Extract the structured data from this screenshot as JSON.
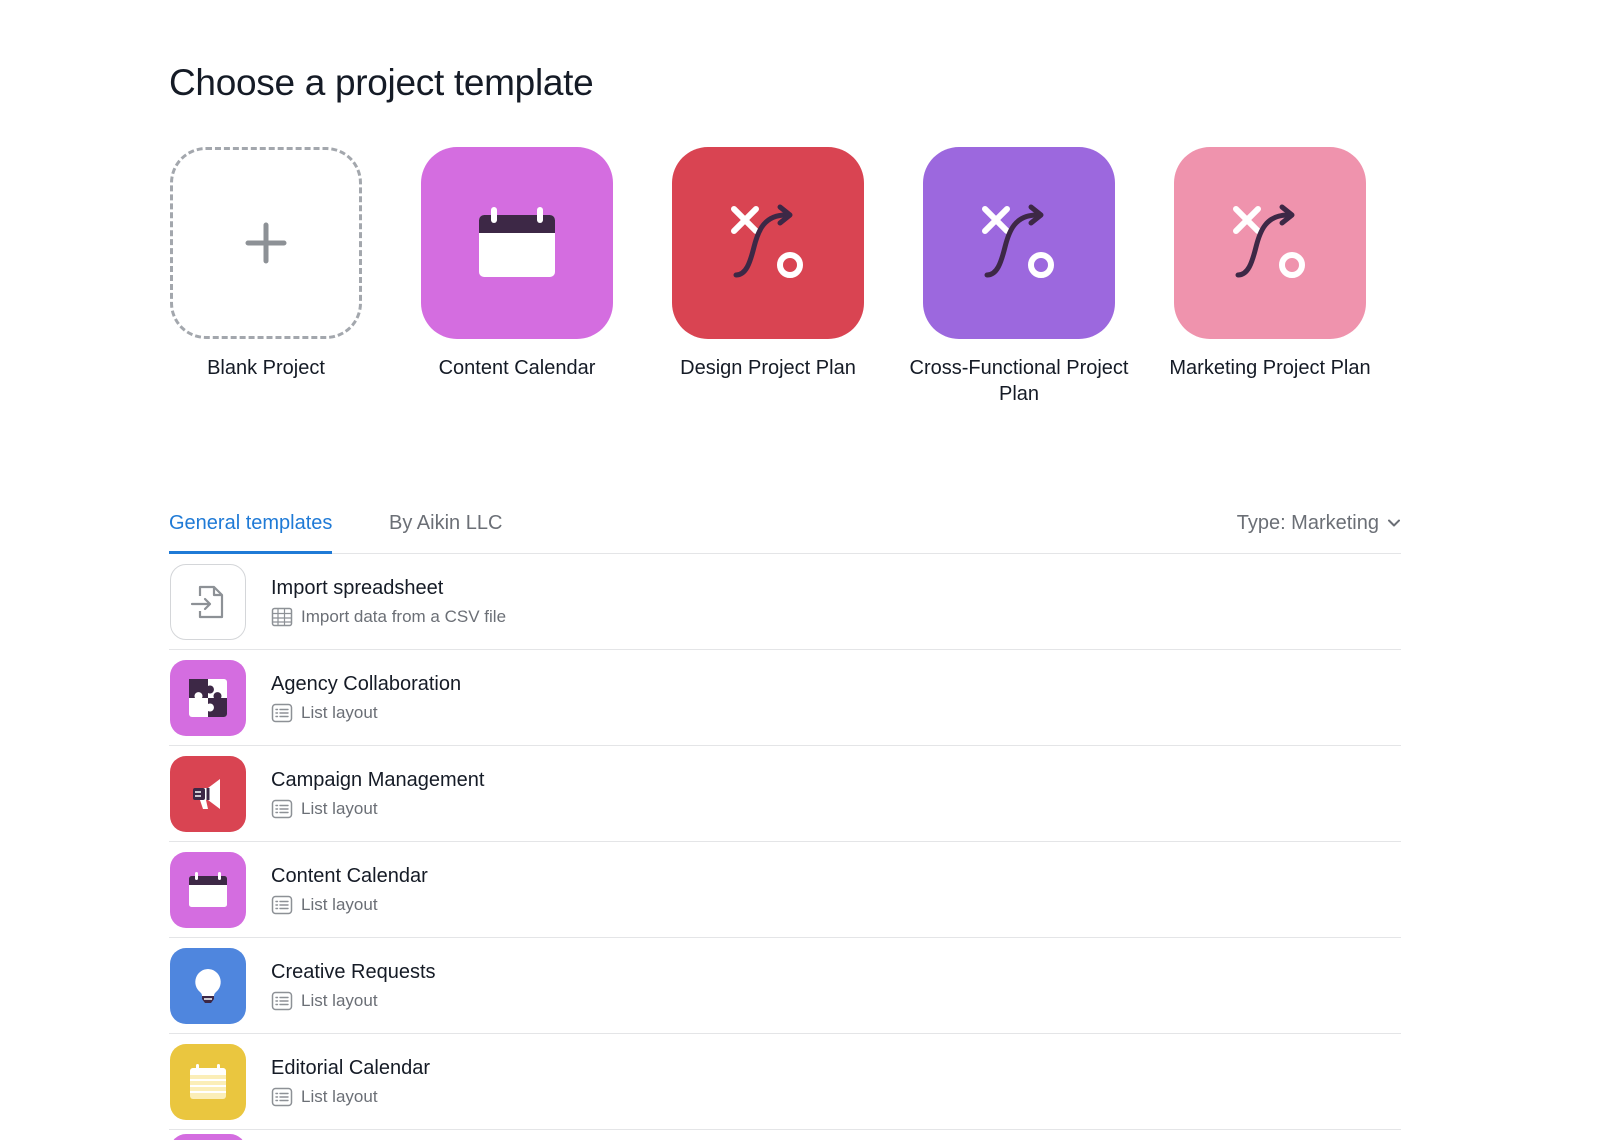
{
  "page": {
    "title": "Choose a project template"
  },
  "featured": [
    {
      "label": "Blank Project",
      "icon": "plus-icon",
      "color": "#ffffff"
    },
    {
      "label": "Content Calendar",
      "icon": "calendar-icon",
      "color": "#d46de0"
    },
    {
      "label": "Design Project Plan",
      "icon": "strategy-icon",
      "color": "#d94452"
    },
    {
      "label": "Cross-Functional Project Plan",
      "icon": "strategy-icon",
      "color": "#9c68de"
    },
    {
      "label": "Marketing Project Plan",
      "icon": "strategy-icon",
      "color": "#ef93ad"
    }
  ],
  "tabs": [
    {
      "label": "General templates",
      "active": true
    },
    {
      "label": "By Aikin LLC",
      "active": false
    }
  ],
  "filter": {
    "label": "Type: Marketing"
  },
  "rows": [
    {
      "title": "Import spreadsheet",
      "subtitle": "Import data from a CSV file",
      "icon": "import-file-icon",
      "sub_icon": "spreadsheet-icon",
      "color": "#ffffff"
    },
    {
      "title": "Agency Collaboration",
      "subtitle": "List layout",
      "icon": "puzzle-icon",
      "sub_icon": "list-layout-icon",
      "color": "#d46de0"
    },
    {
      "title": "Campaign Management",
      "subtitle": "List layout",
      "icon": "megaphone-icon",
      "sub_icon": "list-layout-icon",
      "color": "#d94452"
    },
    {
      "title": "Content Calendar",
      "subtitle": "List layout",
      "icon": "calendar-icon",
      "sub_icon": "list-layout-icon",
      "color": "#d46de0"
    },
    {
      "title": "Creative Requests",
      "subtitle": "List layout",
      "icon": "lightbulb-icon",
      "sub_icon": "list-layout-icon",
      "color": "#4f86de"
    },
    {
      "title": "Editorial Calendar",
      "subtitle": "List layout",
      "icon": "notepad-icon",
      "sub_icon": "list-layout-icon",
      "color": "#eac63f"
    }
  ],
  "colors": {
    "accent": "#1f7ad6",
    "dark_icon": "#3d2846",
    "border": "#e4e5e7",
    "muted_text": "#6b6f76"
  }
}
